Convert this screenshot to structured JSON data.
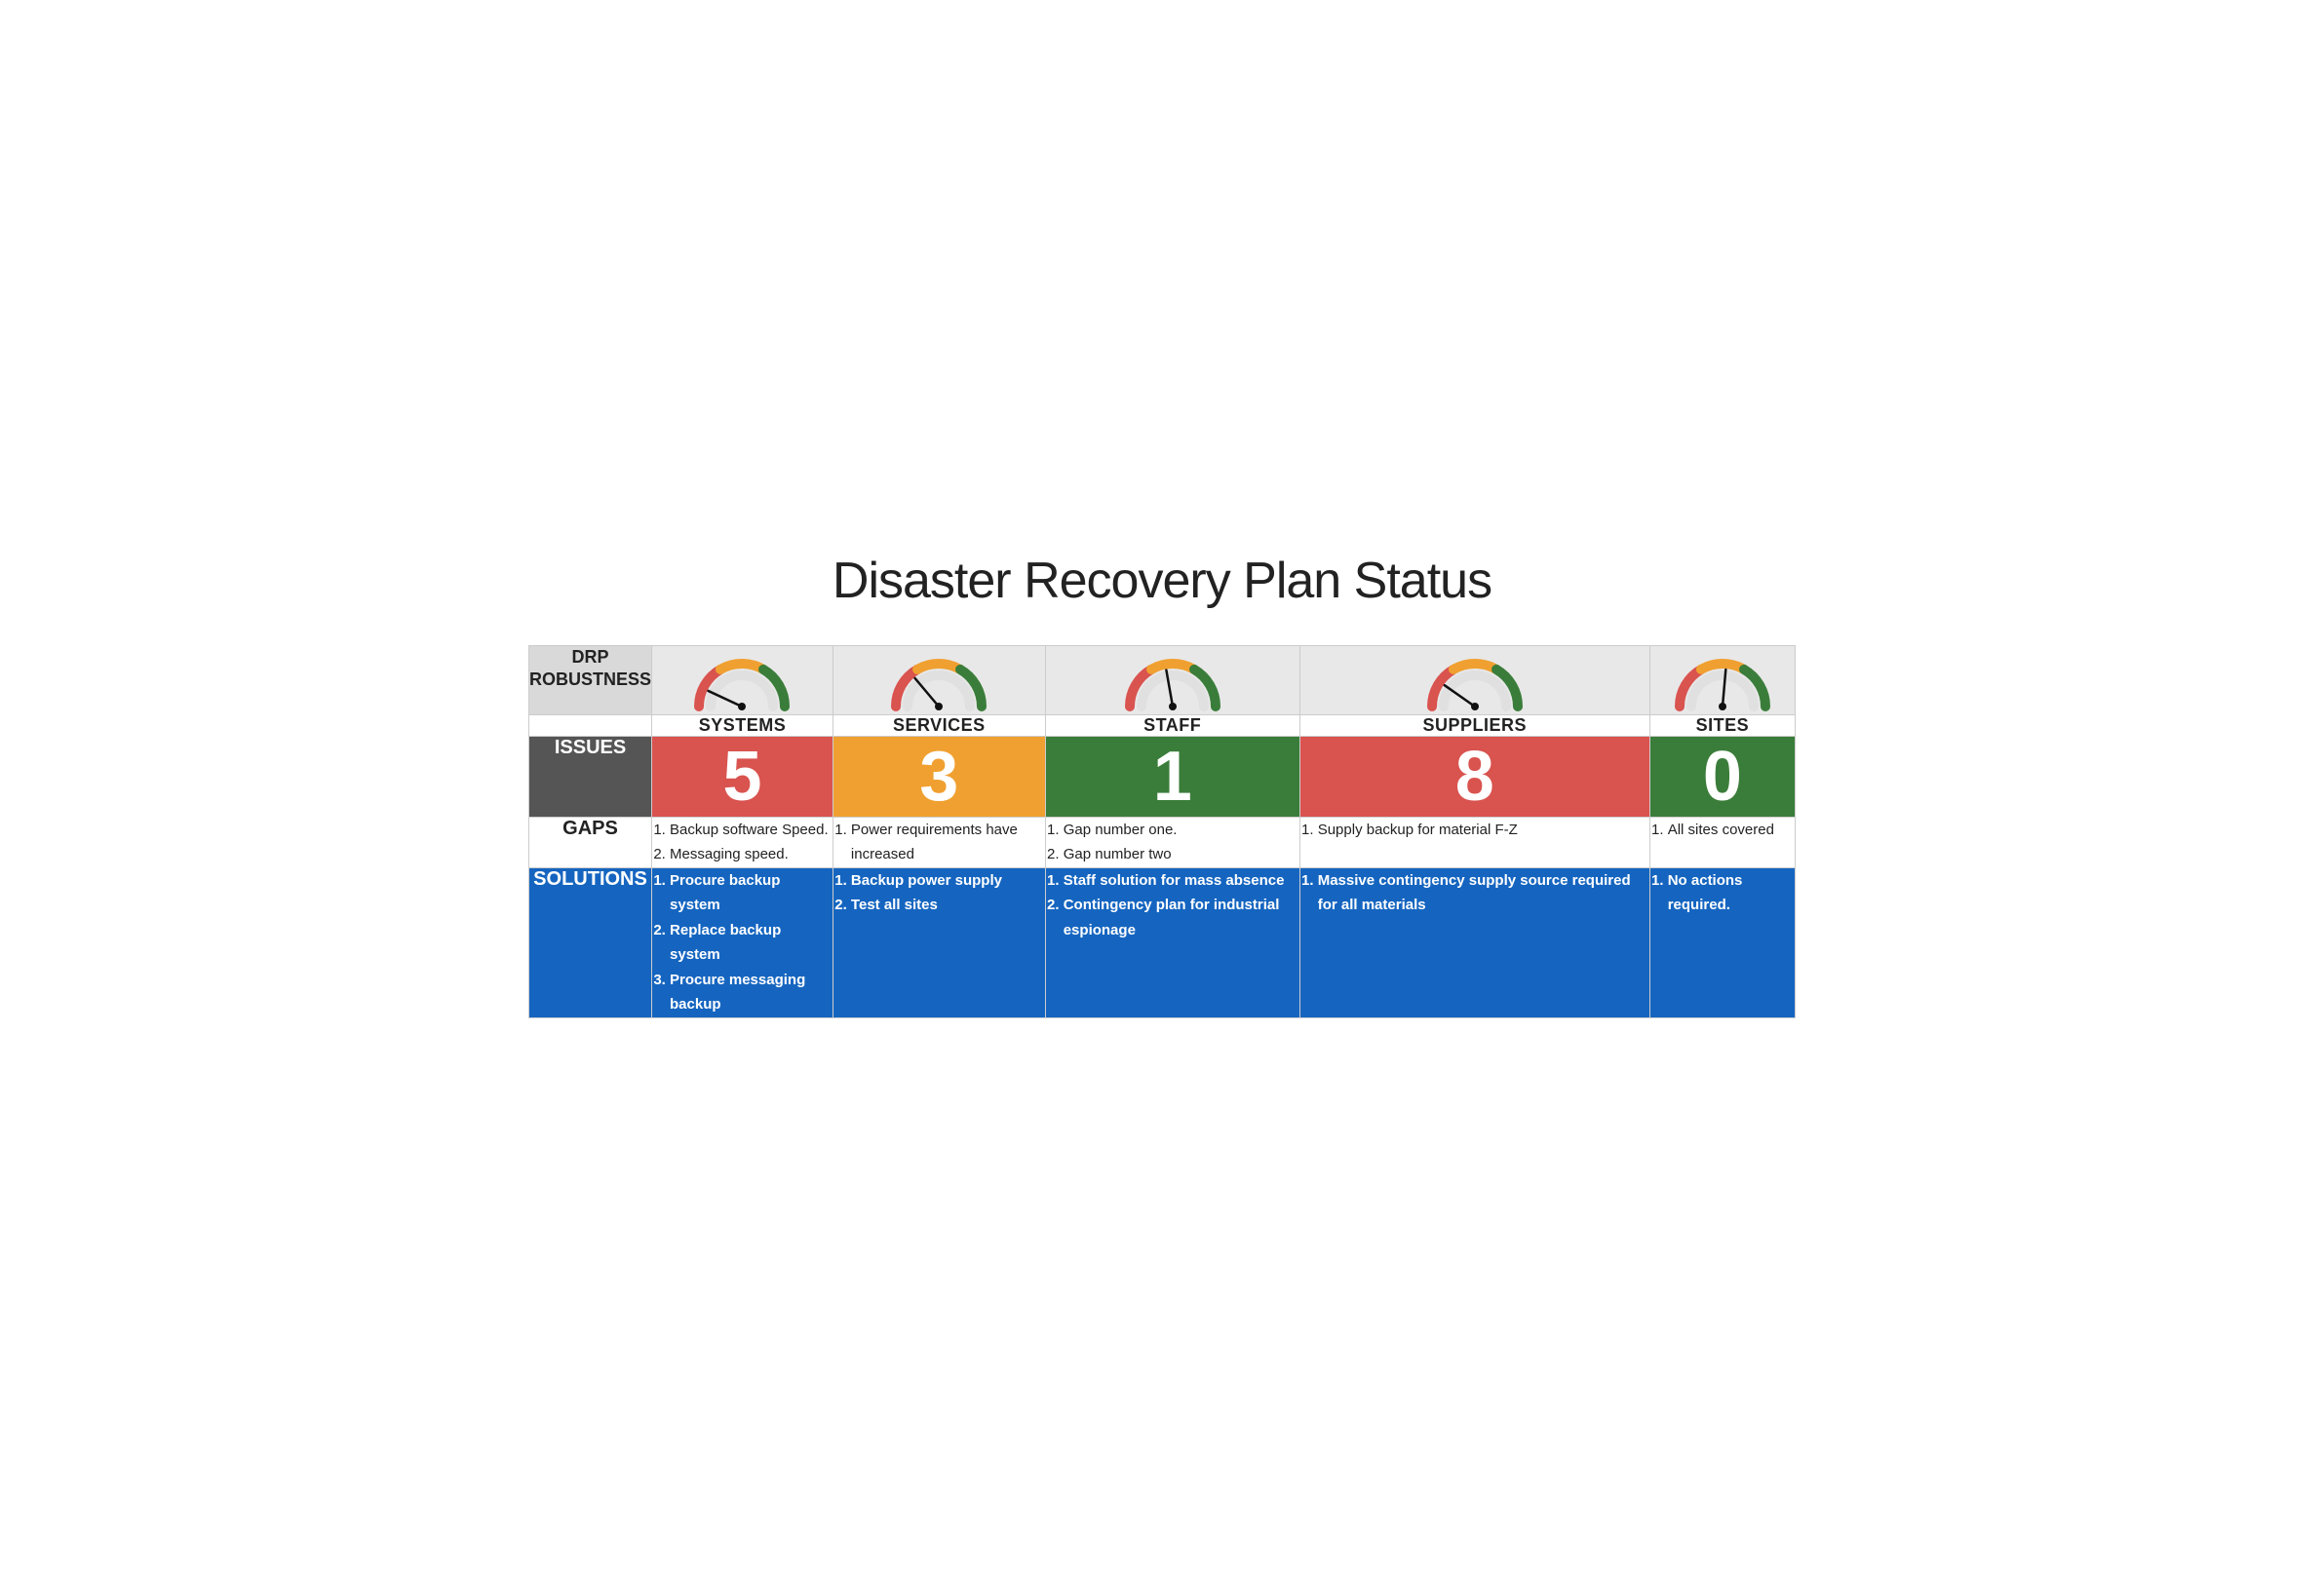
{
  "title": "Disaster Recovery Plan Status",
  "header_label": "DRP\nROBUSTNESS",
  "columns": [
    {
      "id": "systems",
      "label": "SYSTEMS",
      "issues": "5",
      "issues_color": "red",
      "gauge_angle": -110,
      "gaps": [
        "Backup software Speed.",
        "Messaging speed."
      ],
      "solutions": [
        "Procure backup system",
        "Replace backup system",
        "Procure messaging backup"
      ]
    },
    {
      "id": "services",
      "label": "SERVICES",
      "issues": "3",
      "issues_color": "orange",
      "gauge_angle": -60,
      "gaps": [
        "Power requirements have increased"
      ],
      "solutions": [
        "Backup power supply",
        "Test all sites"
      ]
    },
    {
      "id": "staff",
      "label": "STAFF",
      "issues": "1",
      "issues_color": "green",
      "gauge_angle": -20,
      "gaps": [
        "Gap number one.",
        "Gap number two"
      ],
      "solutions": [
        "Staff solution for mass absence",
        "Contingency plan for industrial espionage"
      ]
    },
    {
      "id": "suppliers",
      "label": "SUPPLIERS",
      "issues": "8",
      "issues_color": "red",
      "gauge_angle": -80,
      "gaps": [
        "Supply backup for material F-Z"
      ],
      "solutions": [
        "Massive contingency supply source required for all materials"
      ]
    },
    {
      "id": "sites",
      "label": "SITES",
      "issues": "0",
      "issues_color": "green",
      "gauge_angle": -10,
      "gaps": [
        "All sites covered"
      ],
      "solutions": [
        "No actions required."
      ]
    }
  ],
  "row_labels": {
    "robustness": "DRP ROBUSTNESS",
    "issues": "ISSUES",
    "gaps": "GAPS",
    "solutions": "SOLUTIONS"
  }
}
